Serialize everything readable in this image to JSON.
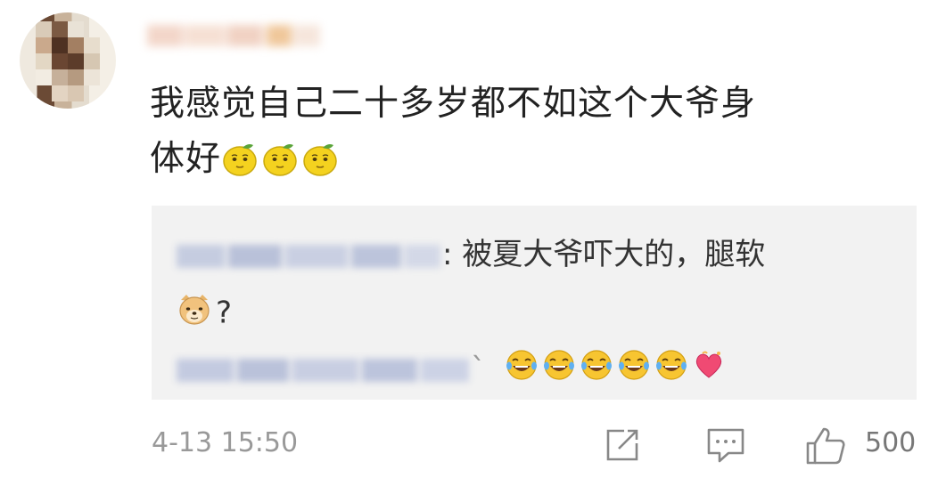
{
  "comment": {
    "text_line1": "我感觉自己二十多岁都不如这个大爷身",
    "text_line2": "体好",
    "emojis": [
      "lemon-emoji",
      "lemon-emoji",
      "lemon-emoji"
    ]
  },
  "replies": [
    {
      "separator": ":",
      "text": "被夏大爷吓大的，腿软",
      "continuation": "?",
      "emojis_before_continuation": [
        "doge-emoji"
      ]
    },
    {
      "separator": "`",
      "emojis": [
        "laugh-cry-emoji",
        "laugh-cry-emoji",
        "laugh-cry-emoji",
        "laugh-cry-emoji",
        "laugh-cry-emoji",
        "heart-emoji"
      ]
    }
  ],
  "footer": {
    "timestamp": "4-13 15:50",
    "like_count": "500",
    "icons": [
      "share-icon",
      "comment-icon",
      "like-icon"
    ]
  },
  "colors": {
    "reply_bg": "#f2f2f2",
    "meta_text": "#999999",
    "body_text": "#222222"
  }
}
